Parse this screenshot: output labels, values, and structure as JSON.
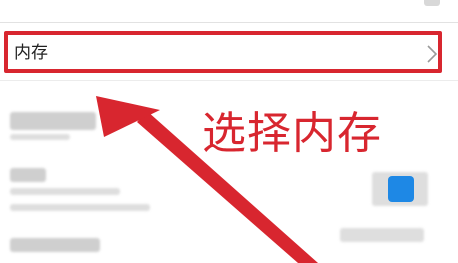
{
  "settings_list": {
    "memory_item": {
      "label": "内存",
      "chevron_icon": "chevron-right-icon"
    }
  },
  "annotation": {
    "text": "选择内存",
    "color": "#d8262f"
  },
  "colors": {
    "highlight": "#d8262f",
    "app_icon": "#1e88e5"
  }
}
